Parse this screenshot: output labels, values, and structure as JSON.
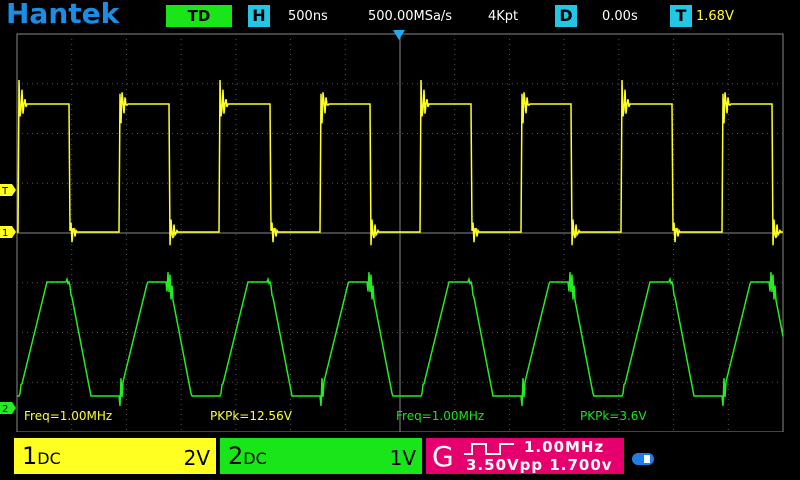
{
  "header": {
    "logo": "Hantek",
    "mode": "TD",
    "h_label": "H",
    "timebase": "500ns",
    "sample_rate": "500.00MSa/s",
    "memory": "4Kpt",
    "d_label": "D",
    "delay": "0.00s",
    "t_label": "T",
    "trigger_level": "1.68V"
  },
  "markers": {
    "trigger": "T",
    "ch1": "1",
    "ch2": "2"
  },
  "measurements": {
    "ch1_freq": "Freq=1.00MHz",
    "ch1_pkpk": "PKPk=12.56V",
    "ch2_freq": "Freq=1.00MHz",
    "ch2_pkpk": "PKPk=3.6V"
  },
  "channels": {
    "ch1": {
      "name": "1",
      "coupling": "DC",
      "scale": "2V",
      "color": "#ffff22"
    },
    "ch2": {
      "name": "2",
      "coupling": "DC",
      "scale": "1V",
      "color": "#19e619"
    }
  },
  "generator": {
    "label": "G",
    "frequency": "1.00MHz",
    "amplitude": "3.50Vpp",
    "offset": "1.700v",
    "color": "#e6006e"
  },
  "colors": {
    "accent": "#22c7e6",
    "logo": "#1a8ee6"
  }
}
